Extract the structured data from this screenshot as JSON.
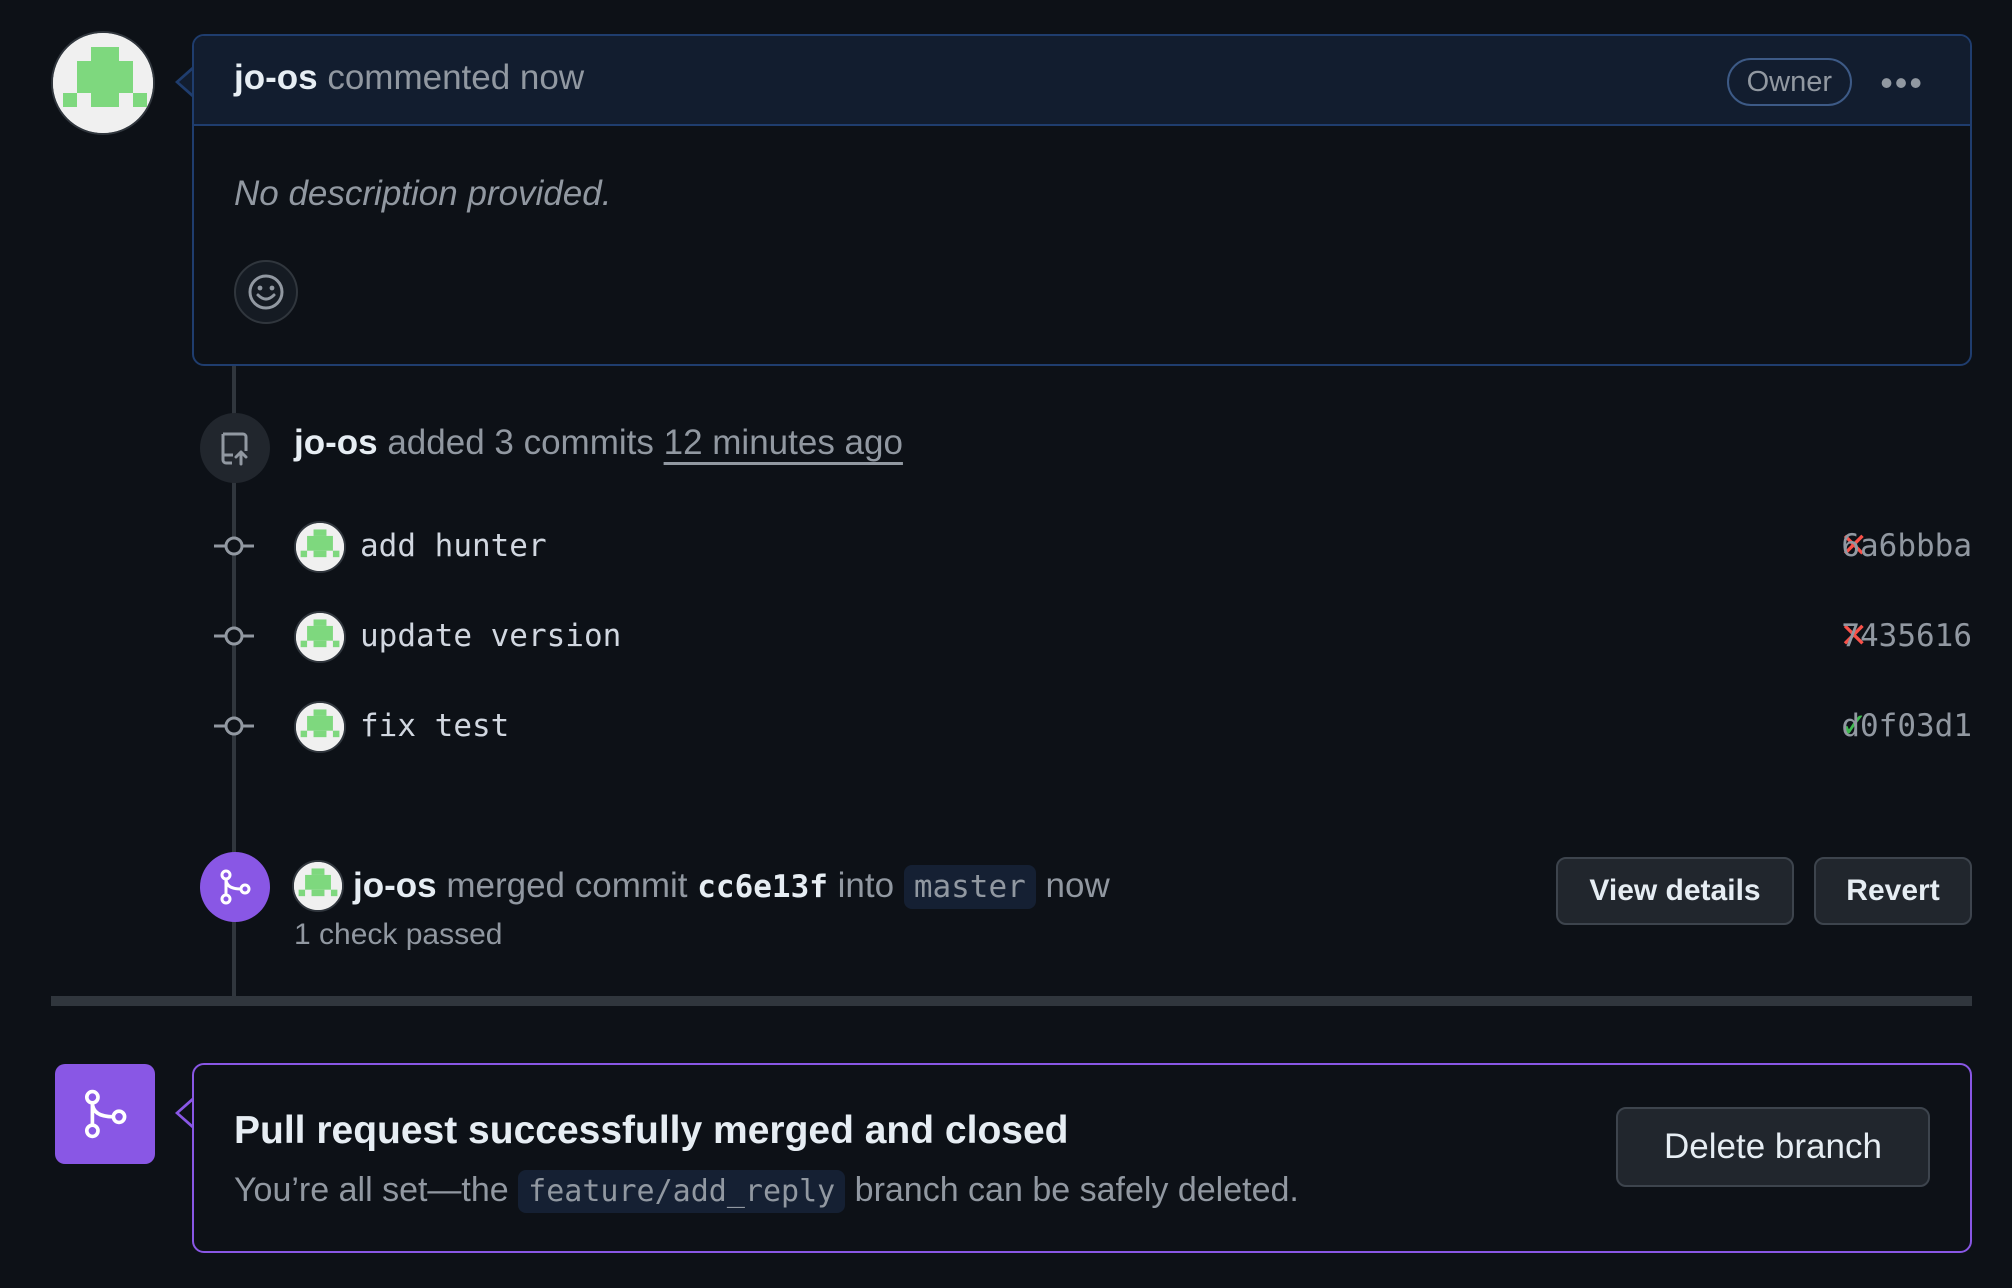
{
  "comment": {
    "author": "jo-os",
    "action": "commented now",
    "badge": "Owner",
    "more_label": "•••",
    "description": "No description provided."
  },
  "push_event": {
    "author": "jo-os",
    "action": "added 3 commits",
    "time": "12 minutes ago"
  },
  "commits": [
    {
      "message": "add hunter",
      "status": "failure",
      "status_glyph": "✕",
      "sha": "6a6bbba"
    },
    {
      "message": "update version",
      "status": "failure",
      "status_glyph": "✕",
      "sha": "7435616"
    },
    {
      "message": "fix test",
      "status": "success",
      "status_glyph": "✓",
      "sha": "d0f03d1"
    }
  ],
  "merge_event": {
    "author": "jo-os",
    "verb": "merged commit",
    "sha": "cc6e13f",
    "into": "into",
    "branch": "master",
    "time": "now",
    "checks": "1 check passed",
    "view_details_label": "View details",
    "revert_label": "Revert"
  },
  "merged_box": {
    "title": "Pull request successfully merged and closed",
    "sub_before": "You’re all set—the",
    "branch": "feature/add_reply",
    "sub_after": "branch can be safely deleted.",
    "delete_label": "Delete branch"
  },
  "colors": {
    "accent_purple": "#8957e5",
    "failure": "#f85149",
    "success": "#3fb950",
    "comment_border": "#1f3d6e"
  },
  "icons": {
    "avatar": "identicon",
    "push": "repo-push-icon",
    "commit_node": "git-commit-icon",
    "merge": "git-merge-icon",
    "emoji": "smiley-icon"
  }
}
